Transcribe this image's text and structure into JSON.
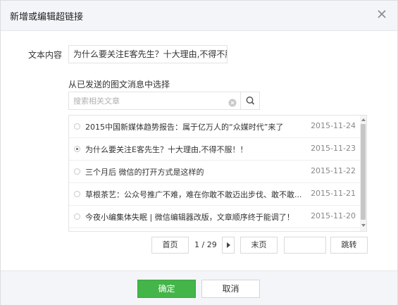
{
  "dialog": {
    "title": "新增或编辑超链接"
  },
  "form": {
    "text_label": "文本内容",
    "text_value": "为什么要关注E客先生？十大理由,不得不服！",
    "select_hint": "从已发送的图文消息中选择"
  },
  "search": {
    "placeholder": "搜索相关文章"
  },
  "articles": [
    {
      "title": "2015中国新媒体趋势报告：属于亿万人的“众媒时代”来了",
      "date": "2015-11-24",
      "selected": false
    },
    {
      "title": "为什么要关注E客先生？十大理由,不得不服！！",
      "date": "2015-11-23",
      "selected": true
    },
    {
      "title": "三个月后 微信的打开方式是这样的",
      "date": "2015-11-22",
      "selected": false
    },
    {
      "title": "草根茶艺：公众号推广不难，难在你敢不敢迈出步伐、敢不敢...",
      "date": "2015-11-21",
      "selected": false
    },
    {
      "title": "今夜小编集体失眠 | 微信编辑器改版，文章顺序终于能调了！",
      "date": "2015-11-20",
      "selected": false
    }
  ],
  "pagination": {
    "first": "首页",
    "info": "1 / 29",
    "last": "末页",
    "jump": "跳转"
  },
  "footer": {
    "confirm": "确定",
    "cancel": "取消"
  },
  "colors": {
    "primary": "#44b549",
    "header_bg": "#f4f5f9"
  }
}
